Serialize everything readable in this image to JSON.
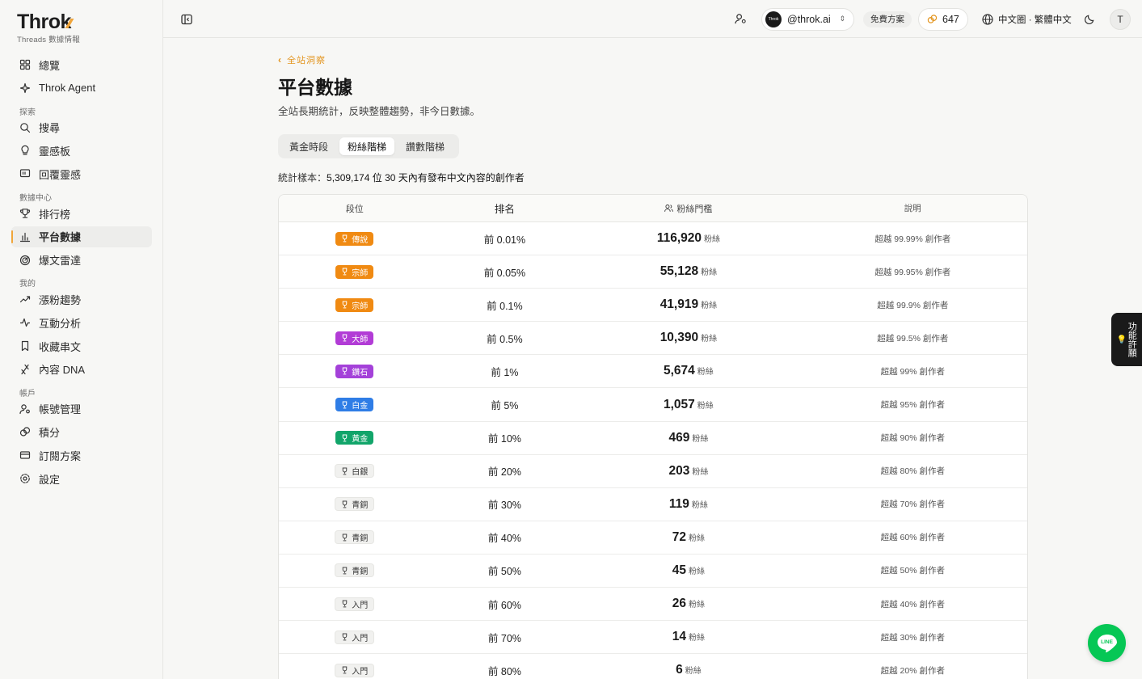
{
  "brand": {
    "name": "Throk",
    "subtitle": "Threads 數據情報"
  },
  "sidebar": {
    "top_items": [
      {
        "label": "總覽",
        "icon": "dashboard-icon"
      },
      {
        "label": "Throk Agent",
        "icon": "sparkle-icon"
      }
    ],
    "sections": [
      {
        "title": "探索",
        "items": [
          {
            "label": "搜尋",
            "icon": "search-icon"
          },
          {
            "label": "靈感板",
            "icon": "lightbulb-icon"
          },
          {
            "label": "回覆靈感",
            "icon": "reply-icon"
          }
        ]
      },
      {
        "title": "數據中心",
        "items": [
          {
            "label": "排行榜",
            "icon": "trophy-icon"
          },
          {
            "label": "平台數據",
            "icon": "bar-chart-icon",
            "active": true
          },
          {
            "label": "爆文雷達",
            "icon": "radar-icon"
          }
        ]
      },
      {
        "title": "我的",
        "items": [
          {
            "label": "漲粉趨勢",
            "icon": "trend-up-icon"
          },
          {
            "label": "互動分析",
            "icon": "activity-icon"
          },
          {
            "label": "收藏串文",
            "icon": "bookmark-icon"
          },
          {
            "label": "內容 DNA",
            "icon": "dna-icon"
          }
        ]
      },
      {
        "title": "帳戶",
        "items": [
          {
            "label": "帳號管理",
            "icon": "user-cog-icon"
          },
          {
            "label": "積分",
            "icon": "coins-icon"
          },
          {
            "label": "訂閱方案",
            "icon": "credit-card-icon"
          },
          {
            "label": "設定",
            "icon": "gear-icon"
          }
        ]
      }
    ]
  },
  "topbar": {
    "account_handle": "@throk.ai",
    "account_avatar_text": "Throk",
    "plan": "免費方案",
    "points": "647",
    "language": "中文圈 · 繁體中文",
    "user_initial": "T"
  },
  "page": {
    "breadcrumb": "全站洞察",
    "title": "平台數據",
    "description": "全站長期統計，反映整體趨勢，非今日數據。",
    "tabs": [
      {
        "label": "黃金時段",
        "active": false
      },
      {
        "label": "粉絲階梯",
        "active": true
      },
      {
        "label": "讚數階梯",
        "active": false
      }
    ],
    "sample_label": "統計樣本：",
    "sample_value": "5,309,174 位 30 天內有發布中文內容的創作者"
  },
  "table": {
    "headers": {
      "tier": "段位",
      "rank": "排名",
      "threshold": "粉絲門檻",
      "note": "說明"
    },
    "unit": "粉絲",
    "rows": [
      {
        "tier": "傳說",
        "color": "#f08a12",
        "rank": "前 0.01%",
        "followers": "116,920",
        "note": "超越 99.99% 創作者"
      },
      {
        "tier": "宗師",
        "color": "#f08a12",
        "rank": "前 0.05%",
        "followers": "55,128",
        "note": "超越 99.95% 創作者"
      },
      {
        "tier": "宗師",
        "color": "#f08a12",
        "rank": "前 0.1%",
        "followers": "41,919",
        "note": "超越 99.9% 創作者"
      },
      {
        "tier": "大師",
        "color": "#b23cd6",
        "rank": "前 0.5%",
        "followers": "10,390",
        "note": "超越 99.5% 創作者"
      },
      {
        "tier": "鑽石",
        "color": "#a441d9",
        "rank": "前 1%",
        "followers": "5,674",
        "note": "超越 99% 創作者"
      },
      {
        "tier": "白金",
        "color": "#2f7de6",
        "rank": "前 5%",
        "followers": "1,057",
        "note": "超越 95% 創作者"
      },
      {
        "tier": "黃金",
        "color": "#12a56a",
        "rank": "前 10%",
        "followers": "469",
        "note": "超越 90% 創作者"
      },
      {
        "tier": "白銀",
        "color": "",
        "rank": "前 20%",
        "followers": "203",
        "note": "超越 80% 創作者"
      },
      {
        "tier": "青銅",
        "color": "",
        "rank": "前 30%",
        "followers": "119",
        "note": "超越 70% 創作者"
      },
      {
        "tier": "青銅",
        "color": "",
        "rank": "前 40%",
        "followers": "72",
        "note": "超越 60% 創作者"
      },
      {
        "tier": "青銅",
        "color": "",
        "rank": "前 50%",
        "followers": "45",
        "note": "超越 50% 創作者"
      },
      {
        "tier": "入門",
        "color": "",
        "rank": "前 60%",
        "followers": "26",
        "note": "超越 40% 創作者"
      },
      {
        "tier": "入門",
        "color": "",
        "rank": "前 70%",
        "followers": "14",
        "note": "超越 30% 創作者"
      },
      {
        "tier": "入門",
        "color": "",
        "rank": "前 80%",
        "followers": "6",
        "note": "超越 20% 創作者"
      }
    ]
  },
  "floating": {
    "wish_label": "功能許願",
    "line_label": "LINE"
  }
}
